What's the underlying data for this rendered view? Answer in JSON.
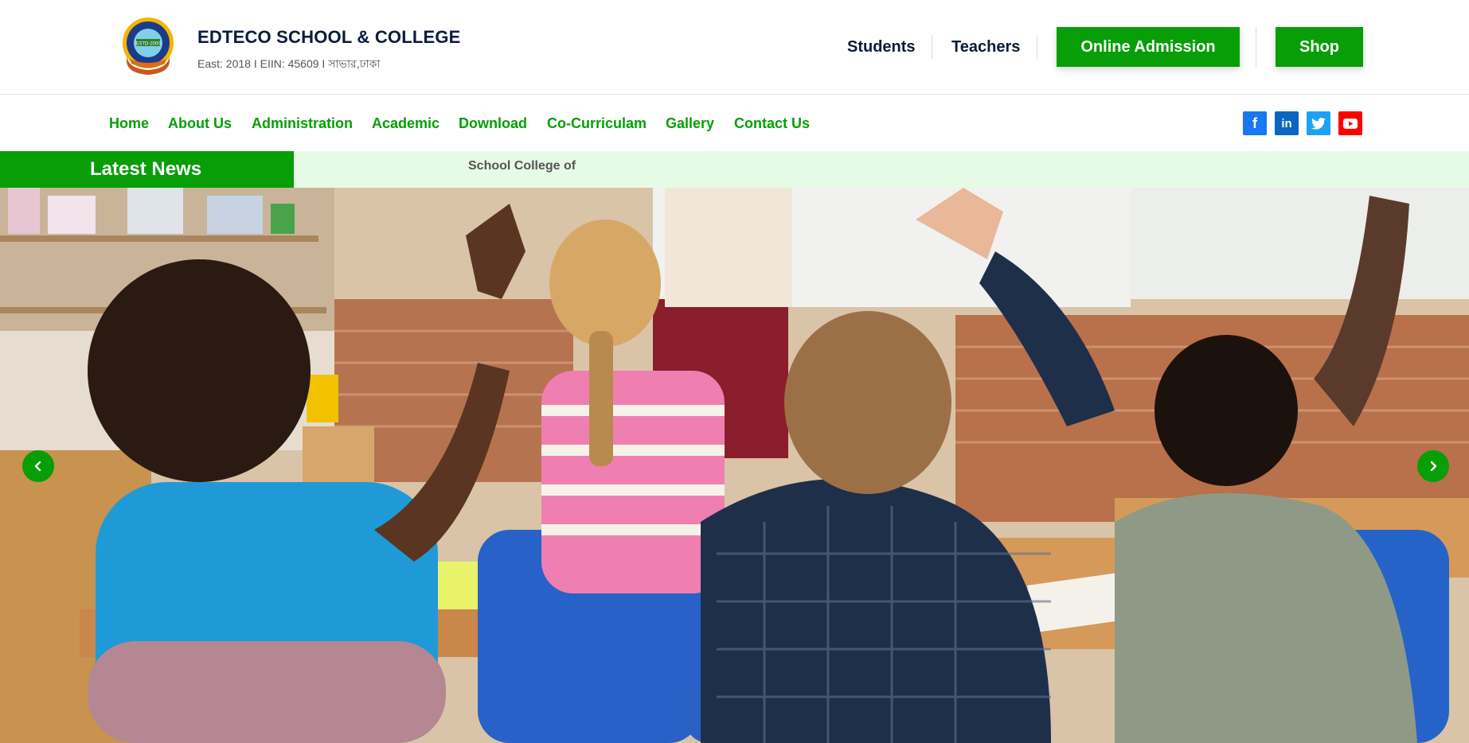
{
  "header": {
    "logo_text": "CHILD LABORATORY SCHOOL NARAYANGANJ ESTD-2000",
    "school_name": "EDTECO SCHOOL & COLLEGE",
    "school_meta": "East: 2018 I EIIN: 45609 I সাভার,ঢাকা",
    "links": {
      "students": "Students",
      "teachers": "Teachers"
    },
    "buttons": {
      "admission": "Online Admission",
      "shop": "Shop"
    }
  },
  "nav": {
    "items": [
      "Home",
      "About Us",
      "Administration",
      "Academic",
      "Download",
      "Co-Curriculam",
      "Gallery",
      "Contact Us"
    ]
  },
  "social": [
    {
      "name": "facebook-icon",
      "glyph": "f"
    },
    {
      "name": "linkedin-icon",
      "glyph": "in"
    },
    {
      "name": "twitter-icon",
      "glyph": ""
    },
    {
      "name": "youtube-icon",
      "glyph": ""
    }
  ],
  "news": {
    "label": "Latest News",
    "ticker": "School College of"
  },
  "slider": {
    "prev": "‹",
    "next": "›"
  },
  "colors": {
    "brand_green": "#079e07",
    "navy_text": "#0b1b3a",
    "news_bg": "#e6fbe6"
  }
}
